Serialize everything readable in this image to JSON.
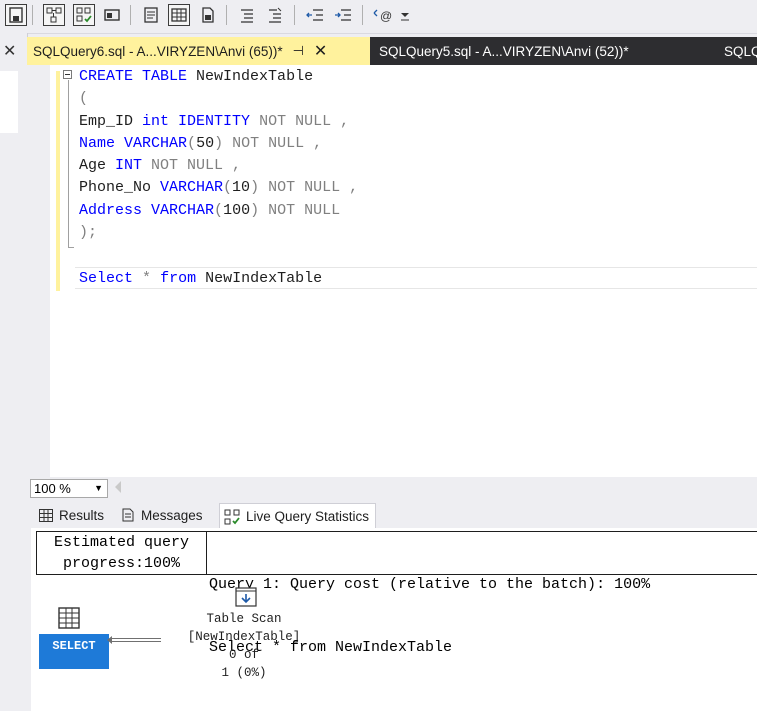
{
  "toolbar": {
    "icons": [
      "save-icon",
      "execution-plan-icon",
      "query-options-icon",
      "results-to-icon",
      "results-to-text-icon",
      "results-to-grid-icon",
      "results-to-file-icon",
      "comment-icon",
      "uncomment-icon",
      "decrease-indent-icon",
      "increase-indent-icon",
      "specify-values-icon",
      "overflow-icon"
    ]
  },
  "tabs": [
    {
      "label": "SQLQuery6.sql - A...VIRYZEN\\Anvi (65))*",
      "active": true
    },
    {
      "label": "SQLQuery5.sql - A...VIRYZEN\\Anvi (52))*",
      "active": false
    },
    {
      "label": "SQLQ",
      "active": false
    }
  ],
  "editor": {
    "lines": [
      {
        "parts": [
          [
            "kw",
            "CREATE"
          ],
          [
            "tx",
            " "
          ],
          [
            "kw",
            "TABLE"
          ],
          [
            "tx",
            " NewIndexTable"
          ]
        ]
      },
      {
        "parts": [
          [
            "gr",
            "("
          ]
        ]
      },
      {
        "parts": [
          [
            "tx",
            "Emp_ID "
          ],
          [
            "kw",
            "int"
          ],
          [
            "tx",
            " "
          ],
          [
            "kw",
            "IDENTITY"
          ],
          [
            "tx",
            " "
          ],
          [
            "gr",
            "NOT NULL ,"
          ]
        ]
      },
      {
        "parts": [
          [
            "kw",
            "Name"
          ],
          [
            "tx",
            " "
          ],
          [
            "kw",
            "VARCHAR"
          ],
          [
            "gr",
            "("
          ],
          [
            "tx",
            "50"
          ],
          [
            "gr",
            ")"
          ],
          [
            "tx",
            " "
          ],
          [
            "gr",
            "NOT NULL ,"
          ]
        ]
      },
      {
        "parts": [
          [
            "tx",
            "Age "
          ],
          [
            "kw",
            "INT"
          ],
          [
            "tx",
            " "
          ],
          [
            "gr",
            "NOT NULL ,"
          ]
        ]
      },
      {
        "parts": [
          [
            "tx",
            "Phone_No "
          ],
          [
            "kw",
            "VARCHAR"
          ],
          [
            "gr",
            "("
          ],
          [
            "tx",
            "10"
          ],
          [
            "gr",
            ")"
          ],
          [
            "tx",
            " "
          ],
          [
            "gr",
            "NOT NULL ,"
          ]
        ]
      },
      {
        "parts": [
          [
            "kw",
            "Address"
          ],
          [
            "tx",
            " "
          ],
          [
            "kw",
            "VARCHAR"
          ],
          [
            "gr",
            "("
          ],
          [
            "tx",
            "100"
          ],
          [
            "gr",
            ")"
          ],
          [
            "tx",
            " "
          ],
          [
            "gr",
            "NOT NULL"
          ]
        ]
      },
      {
        "parts": [
          [
            "gr",
            ");"
          ]
        ]
      },
      {
        "parts": []
      },
      {
        "parts": [
          [
            "kw",
            "Select"
          ],
          [
            "tx",
            " "
          ],
          [
            "gr",
            "*"
          ],
          [
            "tx",
            " "
          ],
          [
            "kw",
            "from"
          ],
          [
            "tx",
            " NewIndexTable"
          ]
        ]
      }
    ]
  },
  "zoom": {
    "value": "100 %"
  },
  "result_tabs": [
    {
      "label": "Results",
      "icon": "grid-icon"
    },
    {
      "label": "Messages",
      "icon": "messages-icon"
    },
    {
      "label": "Live Query Statistics",
      "icon": "live-stats-icon",
      "active": true
    }
  ],
  "results": {
    "progress_line1": "Estimated query",
    "progress_line2": "progress:100%",
    "query_line1": "Query 1: Query cost (relative to the batch): 100%",
    "query_line2": "Select * from NewIndexTable",
    "select_node": "SELECT",
    "scan_line1": "Table Scan",
    "scan_line2": "[NewIndexTable]",
    "scan_line3": "0 of",
    "scan_line4": "1 (0%)"
  },
  "colors": {
    "active_tab": "#fff29d",
    "tab_strip": "#2d2d30",
    "keyword": "#0000ff",
    "gray_keyword": "#808080",
    "select_node": "#1e7ad8"
  }
}
